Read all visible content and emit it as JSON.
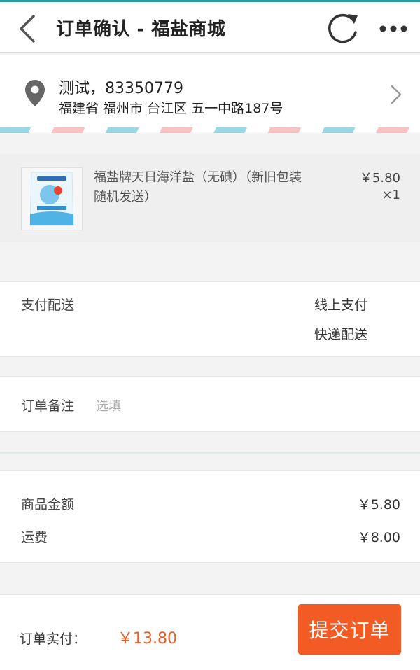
{
  "header": {
    "title": "订单确认 - 福盐商城"
  },
  "address": {
    "name_phone": "测试，83350779",
    "detail": "福建省 福州市 台江区 五一中路187号"
  },
  "product": {
    "name": "福盐牌天日海洋盐（无碘）（新旧包装随机发送）",
    "price": "￥5.80",
    "quantity": "×1"
  },
  "payment": {
    "label": "支付配送",
    "pay_method": "线上支付",
    "delivery_method": "快递配送"
  },
  "note": {
    "label": "订单备注",
    "placeholder": "选填"
  },
  "totals": {
    "goods_label": "商品金额",
    "goods_value": "￥5.80",
    "shipping_label": "运费",
    "shipping_value": "￥8.00"
  },
  "footer": {
    "total_label": "订单实付：",
    "total_value": "￥13.80",
    "submit_label": "提交订单"
  },
  "colors": {
    "accent": "#f35b24",
    "topline": "#2b9aa0"
  }
}
